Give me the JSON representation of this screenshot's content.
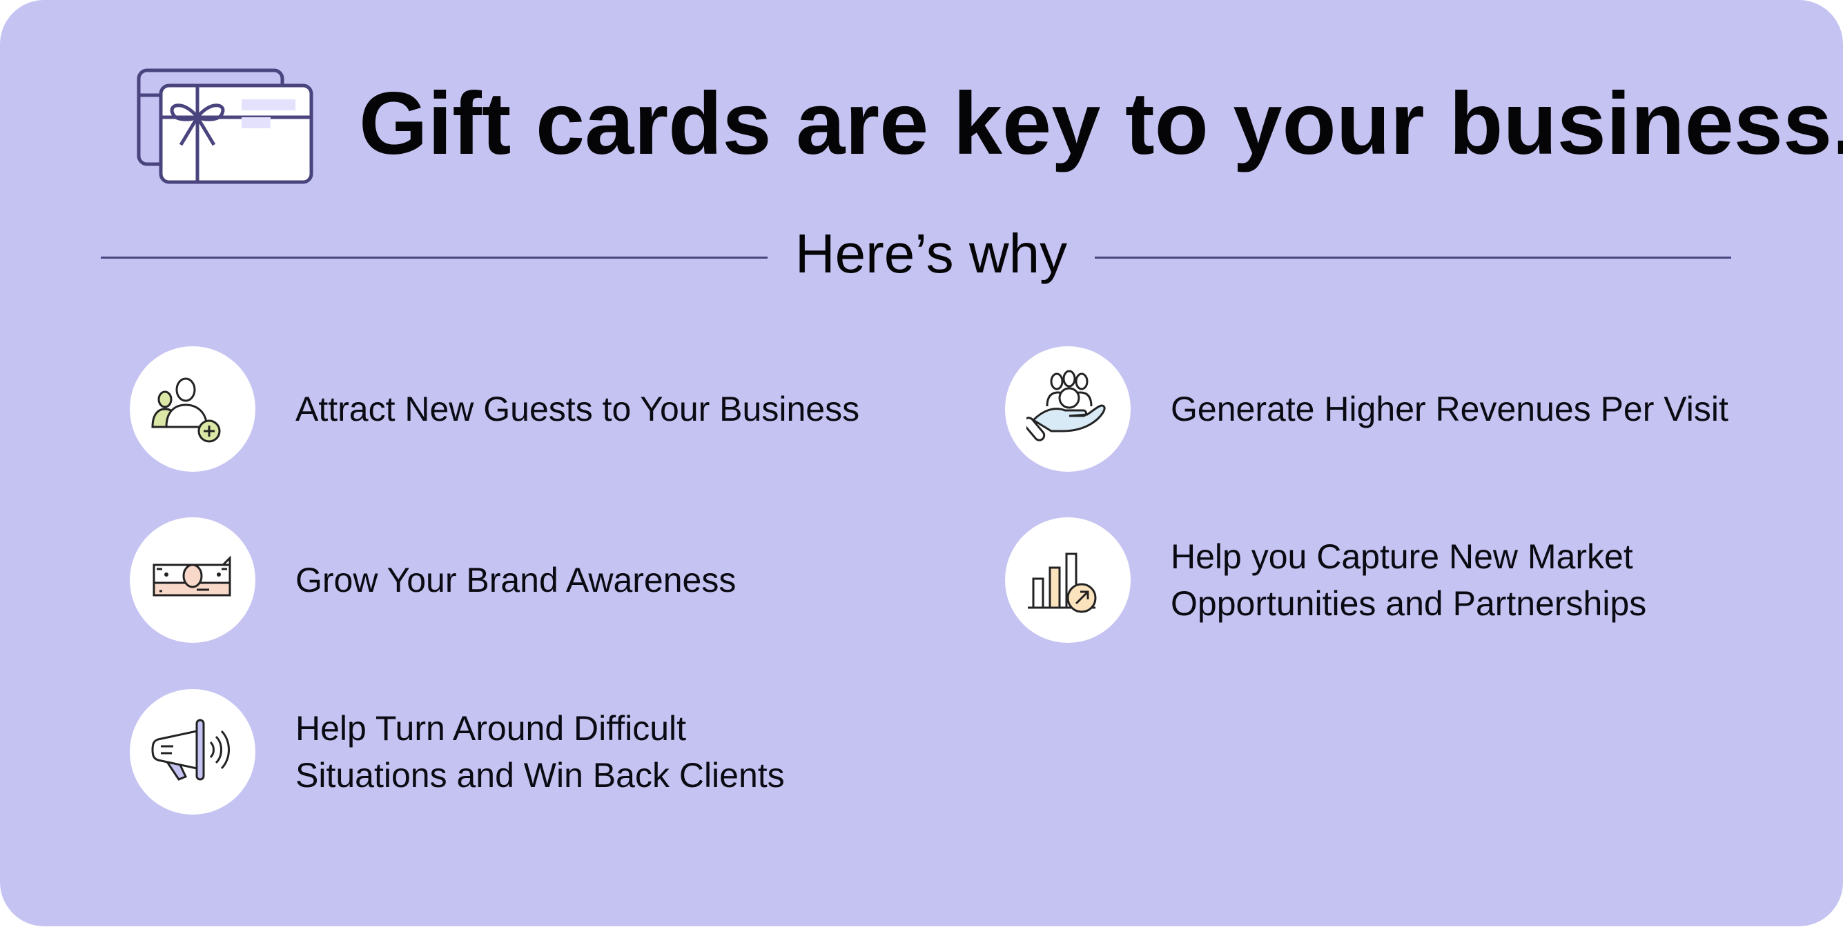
{
  "header": {
    "title": "Gift cards are key to your business.",
    "subtitle": "Here’s why",
    "icon": "gift-cards-icon"
  },
  "colors": {
    "background": "#c5c3f2",
    "circle": "#ffffff",
    "text": "#0a0a12",
    "rule": "#4a447e",
    "icon_stroke": "#4a447e"
  },
  "features": [
    {
      "icon": "new-guests-icon",
      "lines": [
        "Attract New Guests to Your Business"
      ]
    },
    {
      "icon": "money-icon",
      "lines": [
        "Grow Your Brand Awareness"
      ]
    },
    {
      "icon": "megaphone-icon",
      "lines": [
        "Help Turn Around Difficult",
        "Situations and Win Back Clients"
      ]
    },
    {
      "icon": "hand-people-icon",
      "lines": [
        "Generate Higher Revenues Per Visit"
      ]
    },
    {
      "icon": "growth-chart-icon",
      "lines": [
        "Help you Capture New Market",
        "Opportunities and Partnerships"
      ]
    }
  ]
}
